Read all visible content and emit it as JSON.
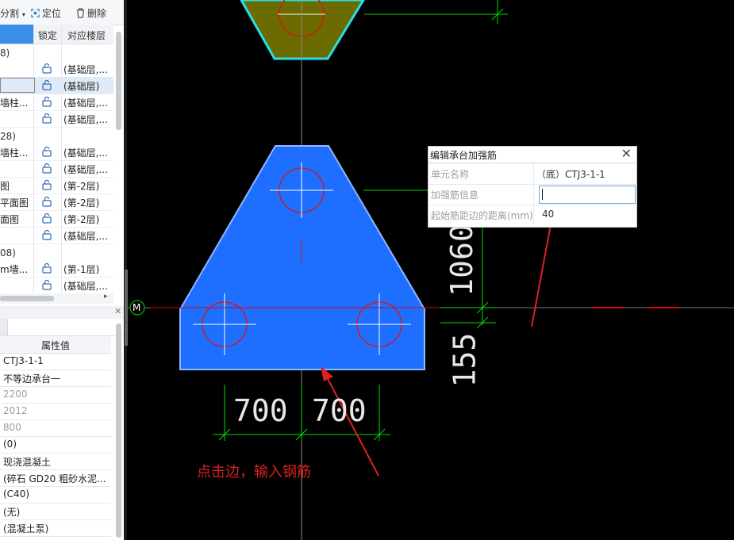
{
  "toolbar": {
    "split_label": "分割",
    "locate_label": "定位",
    "delete_label": "删除"
  },
  "table": {
    "headers": {
      "lock": "锁定",
      "floor": "对应楼层"
    },
    "groups": [
      "8)",
      "28)",
      "08)"
    ],
    "rows": [
      {
        "name": "",
        "floor": "(基础层,..."
      },
      {
        "name": "",
        "floor": "(基础层)"
      },
      {
        "name": "墙柱...",
        "floor": "(基础层,..."
      },
      {
        "name": "",
        "floor": "(基础层,..."
      },
      {
        "name": "墙柱...",
        "floor": "(基础层,..."
      },
      {
        "name": "",
        "floor": "(基础层,..."
      },
      {
        "name": "图",
        "floor": "(第-2层)"
      },
      {
        "name": "平面图",
        "floor": "(第-2层)"
      },
      {
        "name": "面图",
        "floor": "(第-2层)"
      },
      {
        "name": "",
        "floor": "(基础层,..."
      },
      {
        "name": "m墙...",
        "floor": "(第-1层)"
      },
      {
        "name": "",
        "floor": "(基础层,..."
      }
    ]
  },
  "properties": {
    "header": "属性值",
    "values": [
      "CTJ3-1-1",
      "不等边承台一",
      "2200",
      "2012",
      "800",
      "(0)",
      "现浇混凝土",
      "(碎石 GD20 粗砂水泥...",
      "(C40)",
      "(无)",
      "(混凝土泵)"
    ]
  },
  "dialog": {
    "title": "编辑承台加强筋",
    "rows": [
      {
        "label": "单元名称",
        "value": "（底）CTJ3-1-1"
      },
      {
        "label": "加强筋信息",
        "value": ""
      },
      {
        "label": "起始筋距边的距离(mm)",
        "value": "40"
      }
    ]
  },
  "drawing": {
    "dims": {
      "left": "700",
      "right": "700",
      "vertical_upper": "1060",
      "vertical_lower": "155"
    },
    "axis_label": "M",
    "annotation": "点击边，输入钢筋"
  },
  "colors": {
    "shape_fill": "#1e6fff",
    "hex_fill": "#6b6b00",
    "hex_stroke": "#27e0e8",
    "dim": "#00ff00",
    "axis": "#ff0000",
    "annot": "#e02020"
  }
}
